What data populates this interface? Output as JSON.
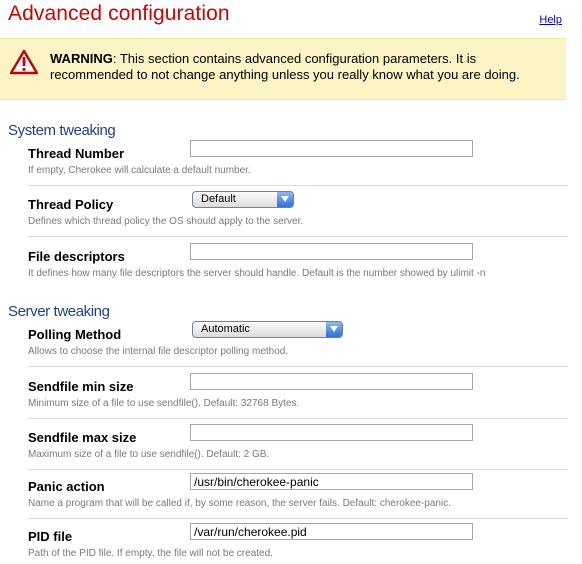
{
  "header": {
    "title": "Advanced configuration",
    "help_label": "Help"
  },
  "warning": {
    "strong": "WARNING",
    "text": ": This section contains advanced configuration parameters. It is recommended to not change anything unless you really know what you are doing."
  },
  "sections": {
    "system": {
      "title": "System tweaking",
      "rows": [
        {
          "label": "Thread Number",
          "type": "input",
          "value": "",
          "desc": "If empty, Cherokee will calculate a default number."
        },
        {
          "label": "Thread Policy",
          "type": "select",
          "value": "Default",
          "desc": "Defines which thread policy the OS should apply to the server."
        },
        {
          "label": "File descriptors",
          "type": "input",
          "value": "",
          "desc": "It defines how many file descriptors the server should handle. Default is the number showed by ulimit -n"
        }
      ]
    },
    "server": {
      "title": "Server tweaking",
      "rows": [
        {
          "label": "Polling Method",
          "type": "select",
          "value": "Automatic",
          "desc": "Allows to choose the internal file descriptor polling method."
        },
        {
          "label": "Sendfile min size",
          "type": "input",
          "value": "",
          "desc": "Minimum size of a file to use sendfile(). Default: 32768 Bytes."
        },
        {
          "label": "Sendfile max size",
          "type": "input",
          "value": "",
          "desc": "Maximum size of a file to use sendfile(). Default: 2 GB."
        },
        {
          "label": "Panic action",
          "type": "input",
          "value": "/usr/bin/cherokee-panic",
          "desc": "Name a program that will be called if, by some reason, the server fails. Default: cherokee-panic."
        },
        {
          "label": "PID file",
          "type": "input",
          "value": "/var/run/cherokee.pid",
          "desc": "Path of the PID file. If empty, the file will not be created."
        }
      ]
    }
  },
  "colors": {
    "title_red": "#d40000",
    "section_blue": "#1f3f8f",
    "warning_bg": "#fcf4c4",
    "select_blue": "#2f6fd6"
  }
}
